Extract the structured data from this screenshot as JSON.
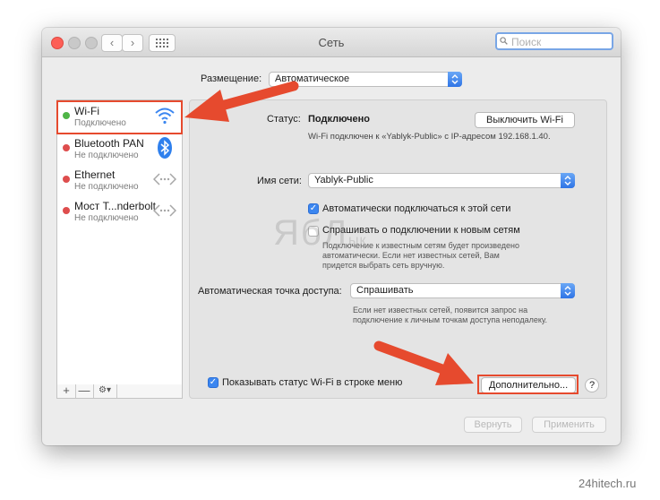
{
  "window": {
    "title": "Сеть",
    "search_placeholder": "Поиск"
  },
  "location": {
    "label": "Размещение:",
    "value": "Автоматическое"
  },
  "services": [
    {
      "name": "Wi-Fi",
      "status": "Подключено",
      "dot_color": "#4fb547",
      "icon": "wifi-icon"
    },
    {
      "name": "Bluetooth PAN",
      "status": "Не подключено",
      "dot_color": "#de4d4d",
      "icon": "bluetooth-icon"
    },
    {
      "name": "Ethernet",
      "status": "Не подключено",
      "dot_color": "#de4d4d",
      "icon": "ethernet-icon"
    },
    {
      "name": "Мост T...nderbolt",
      "status": "Не подключено",
      "dot_color": "#de4d4d",
      "icon": "thunderbolt-bridge-icon"
    }
  ],
  "sidebar_footer": {
    "add": "+",
    "remove": "—",
    "gear": "⚙▾"
  },
  "detail": {
    "status_label": "Статус:",
    "status_value": "Подключено",
    "status_description": "Wi-Fi подключен к «Yablyk-Public» с IP-адресом 192.168.1.40.",
    "turn_off_button": "Выключить Wi-Fi",
    "network_name_label": "Имя сети:",
    "network_name_value": "Yablyk-Public",
    "auto_join_label": "Автоматически подключаться к этой сети",
    "ask_join_label": "Спрашивать о подключении к новым сетям",
    "ask_join_help": [
      "Подключение к известным сетям будет произведено",
      "автоматически. Если нет известных сетей, Вам",
      "придется выбрать сеть вручную."
    ],
    "hotspot_label": "Автоматическая точка доступа:",
    "hotspot_value": "Спрашивать",
    "hotspot_help": [
      "Если нет известных сетей, появится запрос на",
      "подключение к личным точкам доступа неподалеку."
    ],
    "show_status_label": "Показывать статус Wi-Fi в строке меню",
    "advanced_button": "Дополнительно...",
    "help_button": "?"
  },
  "footer": {
    "revert": "Вернуть",
    "apply": "Применить"
  },
  "watermark": {
    "main": "ЯбЛ",
    "small": "ык"
  },
  "site_credit": "24hitech.ru",
  "colors": {
    "accent": "#3b86f0",
    "highlight": "#e64a2e",
    "connected": "#4fb547",
    "disconnected": "#de4d4d"
  }
}
